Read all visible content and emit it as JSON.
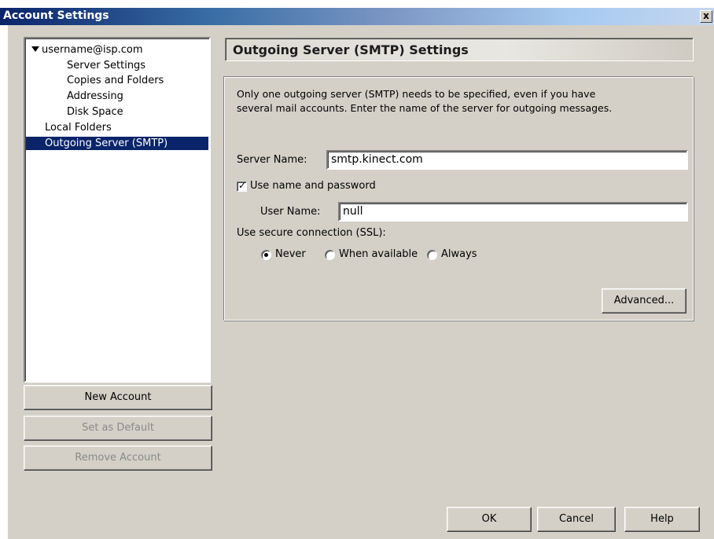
{
  "window": {
    "title": "Account Settings",
    "close_glyph": "x"
  },
  "tree": {
    "account": "username@isp.com",
    "children": [
      "Server Settings",
      "Copies and Folders",
      "Addressing",
      "Disk Space"
    ],
    "local_folders": "Local Folders",
    "outgoing": "Outgoing Server (SMTP)"
  },
  "left_buttons": {
    "new_account": "New Account",
    "set_default": "Set as Default",
    "remove_account": "Remove Account"
  },
  "panel": {
    "header": "Outgoing Server (SMTP) Settings",
    "description_line1": "Only one outgoing server (SMTP) needs to be specified, even if you have",
    "description_line2": "several mail accounts. Enter the name of the server for outgoing messages.",
    "server_name_label": "Server Name:",
    "server_name_value": "smtp.kinect.com",
    "use_name_password_label": "Use name and password",
    "use_name_password_checked": true,
    "user_name_label": "User Name:",
    "user_name_value": "null",
    "ssl_label": "Use secure connection (SSL):",
    "ssl_options": [
      "Never",
      "When available",
      "Always"
    ],
    "ssl_selected": "Never",
    "advanced_button": "Advanced..."
  },
  "footer_buttons": {
    "ok": "OK",
    "cancel": "Cancel",
    "help": "Help"
  }
}
